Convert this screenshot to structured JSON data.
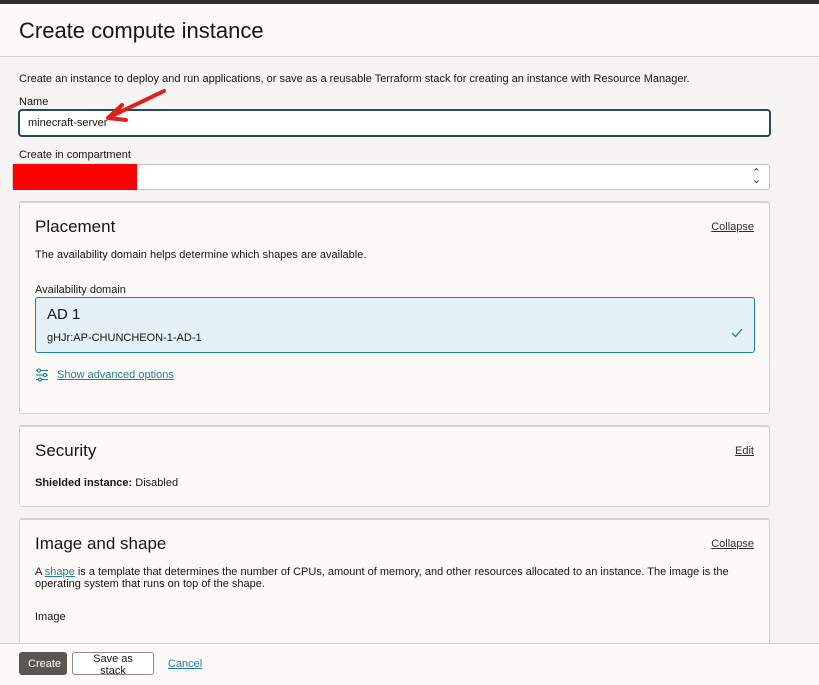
{
  "header": {
    "title": "Create compute instance"
  },
  "intro": "Create an instance to deploy and run applications, or save as a reusable Terraform stack for creating an instance with Resource Manager.",
  "name_field": {
    "label": "Name",
    "value": "minecraft-server"
  },
  "compartment_field": {
    "label": "Create in compartment"
  },
  "placement": {
    "title": "Placement",
    "collapse_label": "Collapse",
    "description": "The availability domain helps determine which shapes are available.",
    "ad_label": "Availability domain",
    "ad_name": "AD 1",
    "ad_code": "gHJr:AP-CHUNCHEON-1-AD-1",
    "advanced_label": "Show advanced options"
  },
  "security": {
    "title": "Security",
    "edit_label": "Edit",
    "shielded_label": "Shielded instance:",
    "shielded_value": "Disabled"
  },
  "image_shape": {
    "title": "Image and shape",
    "collapse_label": "Collapse",
    "desc_prefix": "A",
    "shape_link": "shape",
    "desc_suffix": "is a template that determines the number of CPUs, amount of memory, and other resources allocated to an instance. The image is the operating system that runs on top of the shape.",
    "image_label": "Image"
  },
  "footer": {
    "create_label": "Create",
    "save_stack_label": "Save as stack",
    "cancel_label": "Cancel"
  },
  "colors": {
    "accent_link": "#227e9e",
    "primary_button": "#5b5652",
    "annotation_arrow": "#e0201b",
    "redaction": "#ff0000"
  }
}
